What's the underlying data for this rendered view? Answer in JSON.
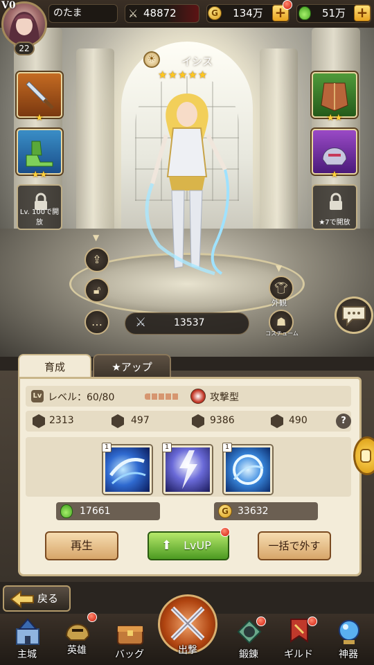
{
  "player": {
    "vip": "V0",
    "name": "のたま",
    "level": "22",
    "power": "48872"
  },
  "currency": {
    "gold": "134万",
    "potion": "51万"
  },
  "hero": {
    "name": "イシス",
    "stars": "★★★★★",
    "battle_power": "13537"
  },
  "equipment": {
    "slot_weapon_stars": "★",
    "slot_boots_stars": "★★",
    "slot_armor_stars": "★★",
    "slot_helmet_stars": "★",
    "left_lock_caption": "Lv. 100で開放",
    "right_lock_caption": "★7で開放"
  },
  "side_buttons": {
    "appearance": "外観",
    "costume": "コスチューム"
  },
  "tabs": {
    "train": "育成",
    "star_up": "★アップ"
  },
  "panel": {
    "level_label": "レベル：60/80",
    "type": "攻撃型",
    "stats": {
      "attack": "2313",
      "defense": "497",
      "hp": "9386",
      "speed": "490"
    },
    "help": "?",
    "skills": [
      {
        "level": "1"
      },
      {
        "level": "1"
      },
      {
        "level": "1"
      }
    ],
    "potion_cost": "17661",
    "gold_cost": "33632",
    "buttons": {
      "rebirth": "再生",
      "levelup": "LvUP",
      "unequip_all": "一括で外す"
    }
  },
  "back": "戻る",
  "nav": {
    "castle": "主城",
    "heroes": "英雄",
    "bag": "バッグ",
    "sortie": "出撃",
    "forge": "鍛錬",
    "guild": "ギルド",
    "artifact": "神器"
  }
}
